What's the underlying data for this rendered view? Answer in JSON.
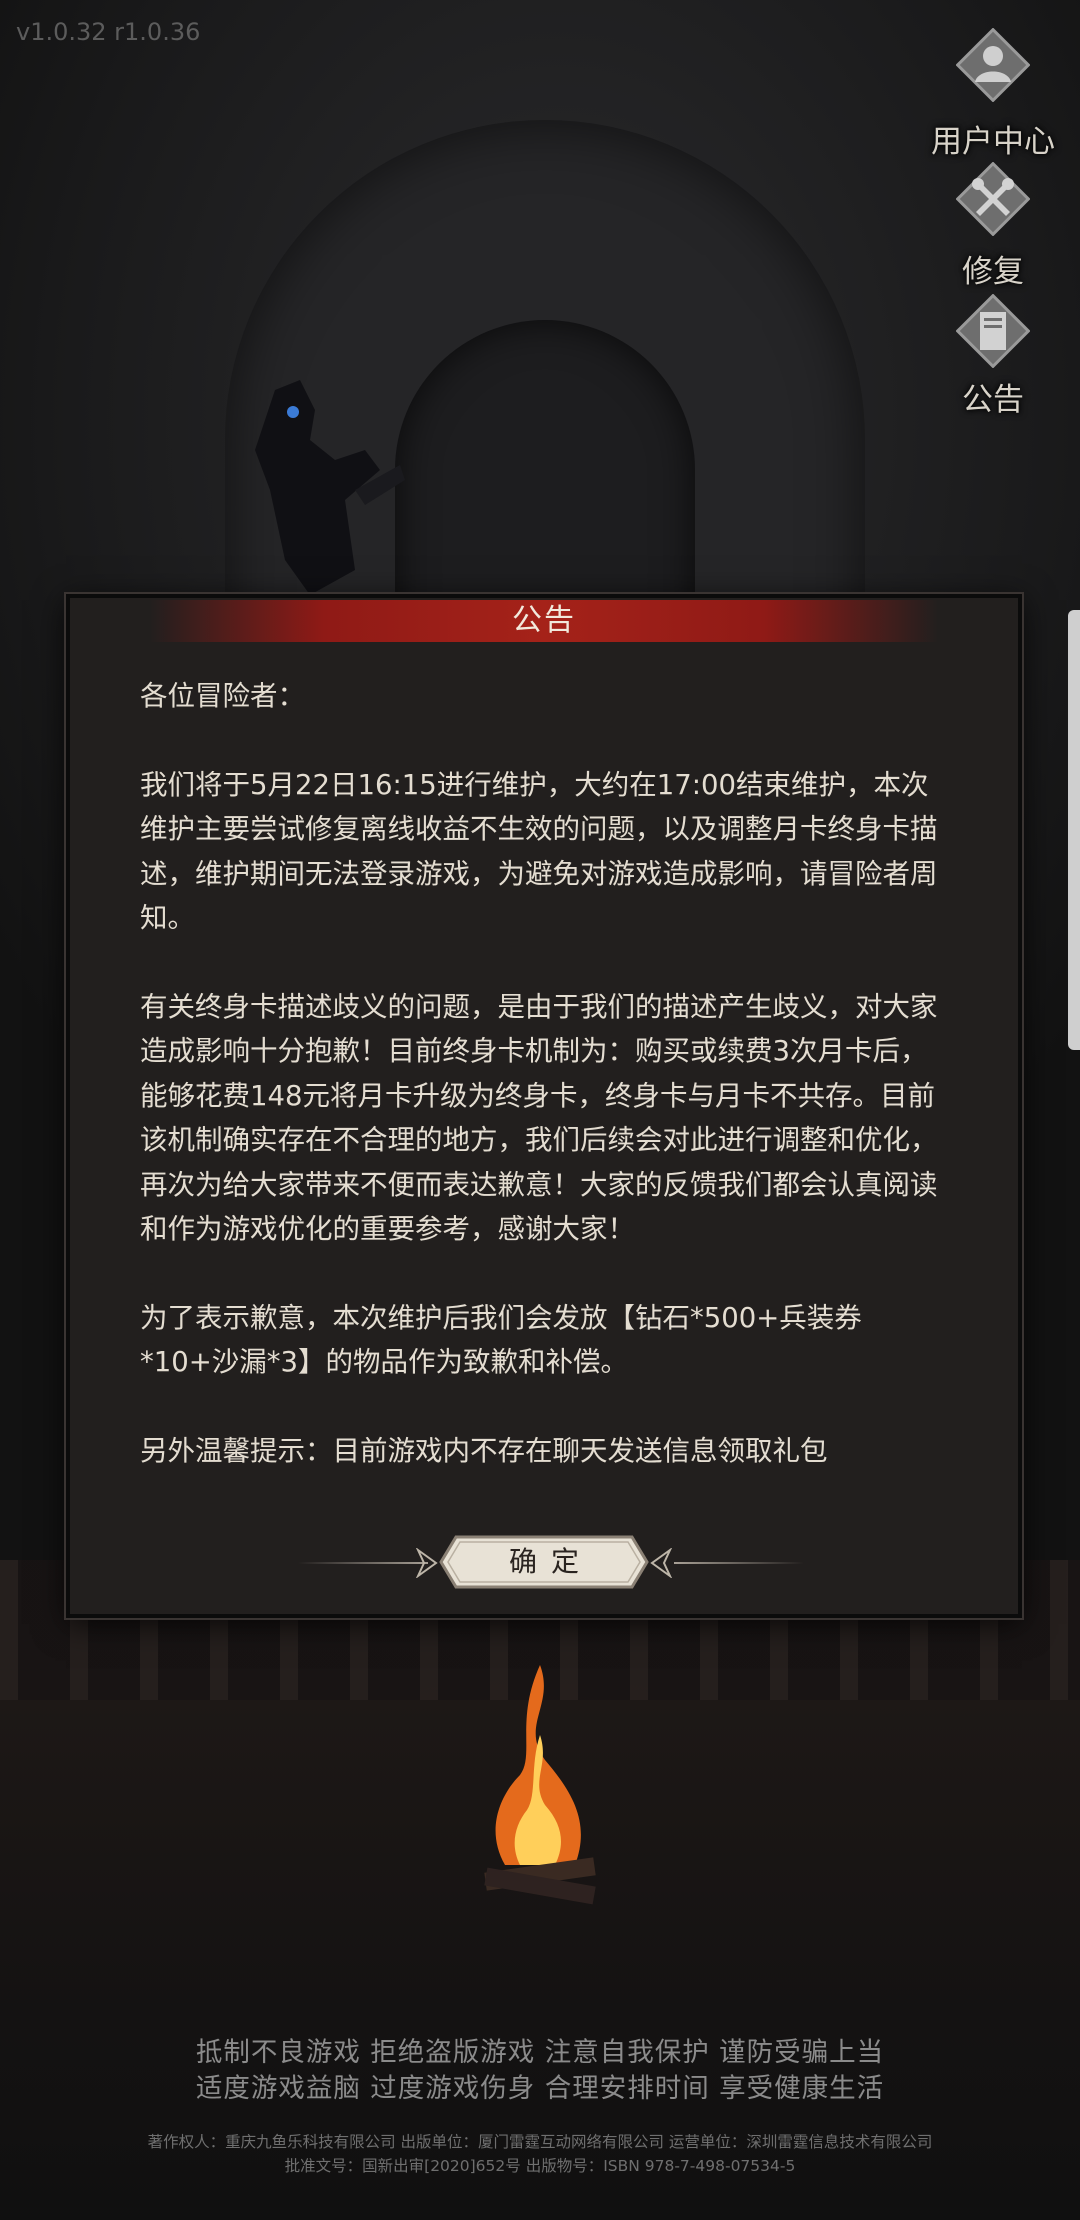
{
  "version": "v1.0.32 r1.0.36",
  "side_buttons": [
    {
      "label": "用户中心",
      "icon": "user-icon"
    },
    {
      "label": "修复",
      "icon": "wrench-icon"
    },
    {
      "label": "公告",
      "icon": "notice-icon"
    }
  ],
  "dialog": {
    "title": "公告",
    "greeting": "各位冒险者：",
    "paragraphs": [
      "我们将于5月22日16:15进行维护，大约在17:00结束维护，本次维护主要尝试修复离线收益不生效的问题，以及调整月卡终身卡描述，维护期间无法登录游戏，为避免对游戏造成影响，请冒险者周知。",
      "有关终身卡描述歧义的问题，是由于我们的描述产生歧义，对大家造成影响十分抱歉！目前终身卡机制为：购买或续费3次月卡后，能够花费148元将月卡升级为终身卡，终身卡与月卡不共存。目前该机制确实存在不合理的地方，我们后续会对此进行调整和优化，再次为给大家带来不便而表达歉意！大家的反馈我们都会认真阅读和作为游戏优化的重要参考，感谢大家！",
      "为了表示歉意，本次维护后我们会发放【钻石*500+兵装券*10+沙漏*3】的物品作为致歉和补偿。",
      "另外温馨提示：目前游戏内不存在聊天发送信息领取礼包"
    ],
    "confirm_label": "确定"
  },
  "footer": {
    "health_line1": "抵制不良游戏 拒绝盗版游戏 注意自我保护 谨防受骗上当",
    "health_line2": "适度游戏益脑 过度游戏伤身 合理安排时间 享受健康生活",
    "copyright_line1": "著作权人：重庆九鱼乐科技有限公司 出版单位：厦门雷霆互动网络有限公司 运营单位：深圳雷霆信息技术有限公司",
    "copyright_line2": "批准文号：国新出审[2020]652号 出版物号：ISBN 978-7-498-07534-5"
  },
  "colors": {
    "header_red": "#a52219",
    "dialog_bg": "#221f1e",
    "button_bg": "#e8e2d6"
  }
}
